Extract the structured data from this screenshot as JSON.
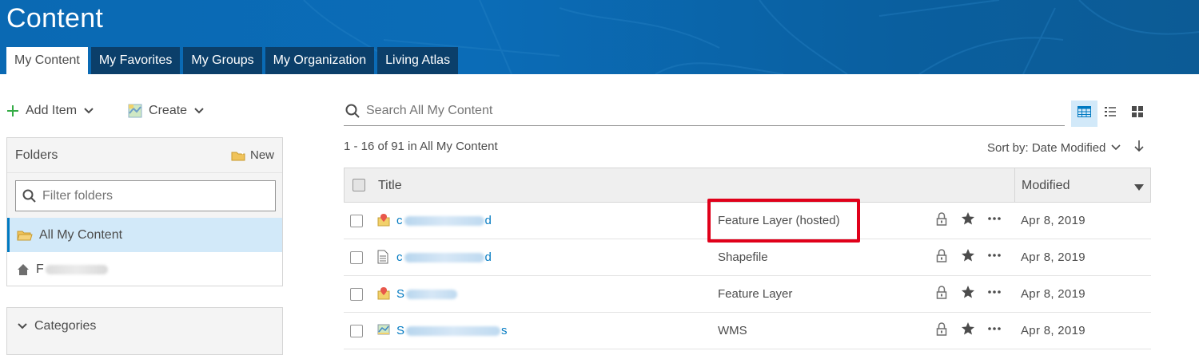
{
  "header": {
    "title": "Content",
    "tabs": [
      {
        "label": "My Content",
        "active": true
      },
      {
        "label": "My Favorites",
        "active": false
      },
      {
        "label": "My Groups",
        "active": false
      },
      {
        "label": "My Organization",
        "active": false
      },
      {
        "label": "Living Atlas",
        "active": false
      }
    ]
  },
  "sidebar": {
    "add_item_label": "Add Item",
    "create_label": "Create",
    "folders": {
      "heading": "Folders",
      "new_label": "New",
      "filter_placeholder": "Filter folders",
      "items": [
        {
          "label": "All My Content",
          "active": true,
          "icon": "folder-open-icon"
        },
        {
          "label": "F",
          "active": false,
          "icon": "home-icon"
        }
      ]
    },
    "categories_label": "Categories"
  },
  "main": {
    "search_placeholder": "Search All My Content",
    "view_modes": [
      {
        "icon": "table-view-icon",
        "active": true
      },
      {
        "icon": "list-view-icon",
        "active": false
      },
      {
        "icon": "grid-view-icon",
        "active": false
      }
    ],
    "result_count": "1 - 16 of 91 in All My Content",
    "sort_label": "Sort by: Date Modified",
    "table": {
      "headers": {
        "title": "Title",
        "modified": "Modified"
      },
      "rows": [
        {
          "title_start": "c",
          "title_end": "d",
          "type": "Feature Layer (hosted)",
          "modified": "Apr 8, 2019",
          "icon": "feature-layer-icon"
        },
        {
          "title_start": "c",
          "title_end": "d",
          "type": "Shapefile",
          "modified": "Apr 8, 2019",
          "icon": "document-icon"
        },
        {
          "title_start": "S",
          "title_end": "",
          "type": "Feature Layer",
          "modified": "Apr 8, 2019",
          "icon": "feature-layer-icon"
        },
        {
          "title_start": "S",
          "title_end": "s",
          "type": "WMS",
          "modified": "Apr 8, 2019",
          "icon": "map-service-icon"
        }
      ]
    }
  },
  "colors": {
    "banner": "#0a69b3",
    "tab_dark": "#0b3f6a",
    "link": "#0079c1",
    "selected_bg": "#d2e9f9",
    "highlight": "#e0001a"
  }
}
